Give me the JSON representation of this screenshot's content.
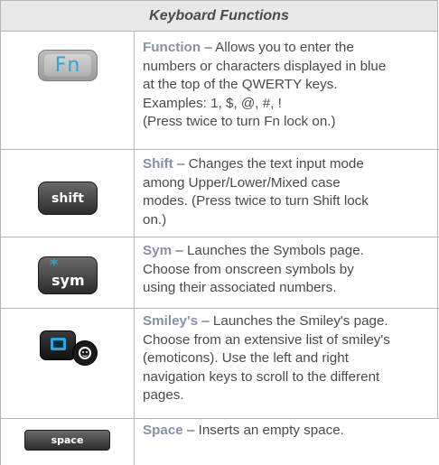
{
  "table": {
    "title": "Keyboard Functions",
    "rows": [
      {
        "key_label": "Fn",
        "name": "Function",
        "text_lines": [
          "Allows you to enter the",
          "numbers or characters displayed in blue",
          "at the top of the QWERTY keys.",
          "Examples: 1, $, @, #, !",
          "(Press twice to turn Fn lock on.)"
        ],
        "icon": "fn-key-icon"
      },
      {
        "key_label": "shift",
        "name": "Shift",
        "text_lines": [
          "Changes the text input mode",
          "among Upper/Lower/Mixed case",
          "modes. (Press twice to turn Shift lock",
          "on.)"
        ],
        "icon": "shift-key-icon"
      },
      {
        "key_label": "sym",
        "key_star": "*",
        "name": "Sym",
        "text_lines": [
          "Launches the Symbols page.",
          "Choose from onscreen symbols by",
          "using their associated numbers."
        ],
        "icon": "sym-key-icon"
      },
      {
        "name": "Smiley's",
        "text_lines": [
          "Launches the Smiley's page.",
          "Choose from an extensive list of smiley's",
          "(emoticons). Use the left and right",
          "navigation keys to scroll to the different",
          "pages."
        ],
        "icon": "smiley-key-icon"
      },
      {
        "key_label": "space",
        "name": "Space",
        "text_lines": [
          "Inserts an empty space."
        ],
        "icon": "space-key-icon"
      }
    ],
    "separator": " – "
  },
  "colors": {
    "header_bg": "#e8e8e8",
    "border": "#b5b5b5",
    "term_color": "#8a8fa8",
    "accent_blue": "#2aa7d3"
  }
}
